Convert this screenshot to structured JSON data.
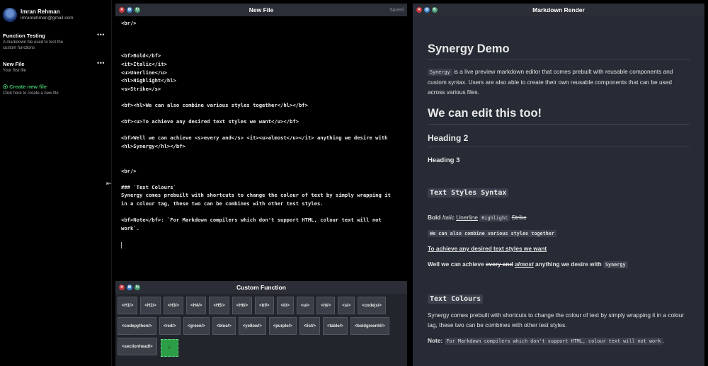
{
  "user": {
    "name": "Imran Rehman",
    "email": "imranrehman@gmail.com"
  },
  "sidebar": {
    "more_glyph": "•••",
    "files": [
      {
        "title": "Function Testing",
        "desc": "A markdown file used to test the custom functions"
      },
      {
        "title": "New File",
        "desc": "Your first file"
      }
    ],
    "create": {
      "title": "Create new file",
      "desc": "Click here to create a new file"
    },
    "collapse_glyph": "⇤"
  },
  "editor": {
    "title": "New File",
    "status": "Saved",
    "lines": [
      "<br/>",
      "",
      "",
      "",
      "<bf>Bold</bf>",
      "<it>Italic</it>",
      "<u>Unerline</u>",
      "<hl>Highlight</hl>",
      "<s>Strike</s>",
      "",
      "<bf><hl>We can also combine various styles together</hl></bf>",
      "",
      "<bf><u>To achieve any desired text styles we want</u></bf>",
      "",
      "<bf>Well we can achieve <s>every and</s> <it><u>almost</u></it> anything we desire with",
      "<hl>Synergy</hl></bf>",
      "",
      "",
      "<br/>",
      "",
      "### `Text Colours`",
      "Synergy comes prebuilt with shortcuts to change the colour of text by simply wrapping it",
      "in a colour tag, these two can be combines with other test styles.",
      "",
      "<bf>Note</bf>: `For Markdown compilers which don't support HTML, colour text will not",
      "work`.",
      ""
    ]
  },
  "custom_function": {
    "title": "Custom Function",
    "chips": [
      "<H1/>",
      "<H2/>",
      "<H3/>",
      "<H4/>",
      "<H5/>",
      "<H6/>",
      "<bf/>",
      "<it/>",
      "<u/>",
      "<hl/>",
      "<s/>",
      "<codejs/>",
      "<codepython/>",
      "<red/>",
      "<green/>",
      "<blue/>",
      "<yellow/>",
      "<purple/>",
      "<list/>",
      "<table/>",
      "<boldgreenhl/>",
      "<sectionhead/>"
    ],
    "add_label": "+"
  },
  "render": {
    "title": "Markdown Render",
    "h1": "Synergy Demo",
    "intro_code": "Synergy",
    "intro_text": " is a live preview markdown editor that comes prebuilt with reusable components and custom syntax. Users are also able to create their own reusable components that can be used across various files.",
    "h1b": "We can edit this too!",
    "h2": "Heading 2",
    "h3": "Heading 3",
    "styles_heading": "Text Styles Syntax",
    "bold": "Bold",
    "italic": "Italic",
    "underline": "Unerline",
    "highlight": "Highlight",
    "strike": "Strike",
    "combined": "We can also combine various styles together",
    "underline_bold": "To achieve any desired text styles we want",
    "well_prefix": "Well we can achieve ",
    "well_strike": "every and",
    "well_italic": "almost",
    "well_suffix": " anything we desire with ",
    "well_code": "Synergy",
    "colours_heading": "Text Colours",
    "colours_text": "Synergy comes prebuilt with shortcuts to change the colour of text by simply wrapping it in a colour tag, these two can be combines with other test styles.",
    "note_label": "Note:",
    "note_code": "For Markdown compilers which don't support HTML, colour text will not work",
    "note_end": "."
  },
  "window_controls": {
    "close": "✕",
    "settings": "⚙",
    "refresh": "↻"
  },
  "colors": {
    "accent_green": "#3fc46a",
    "titlebar": "#2b2e36",
    "render_bg": "#262b35"
  }
}
